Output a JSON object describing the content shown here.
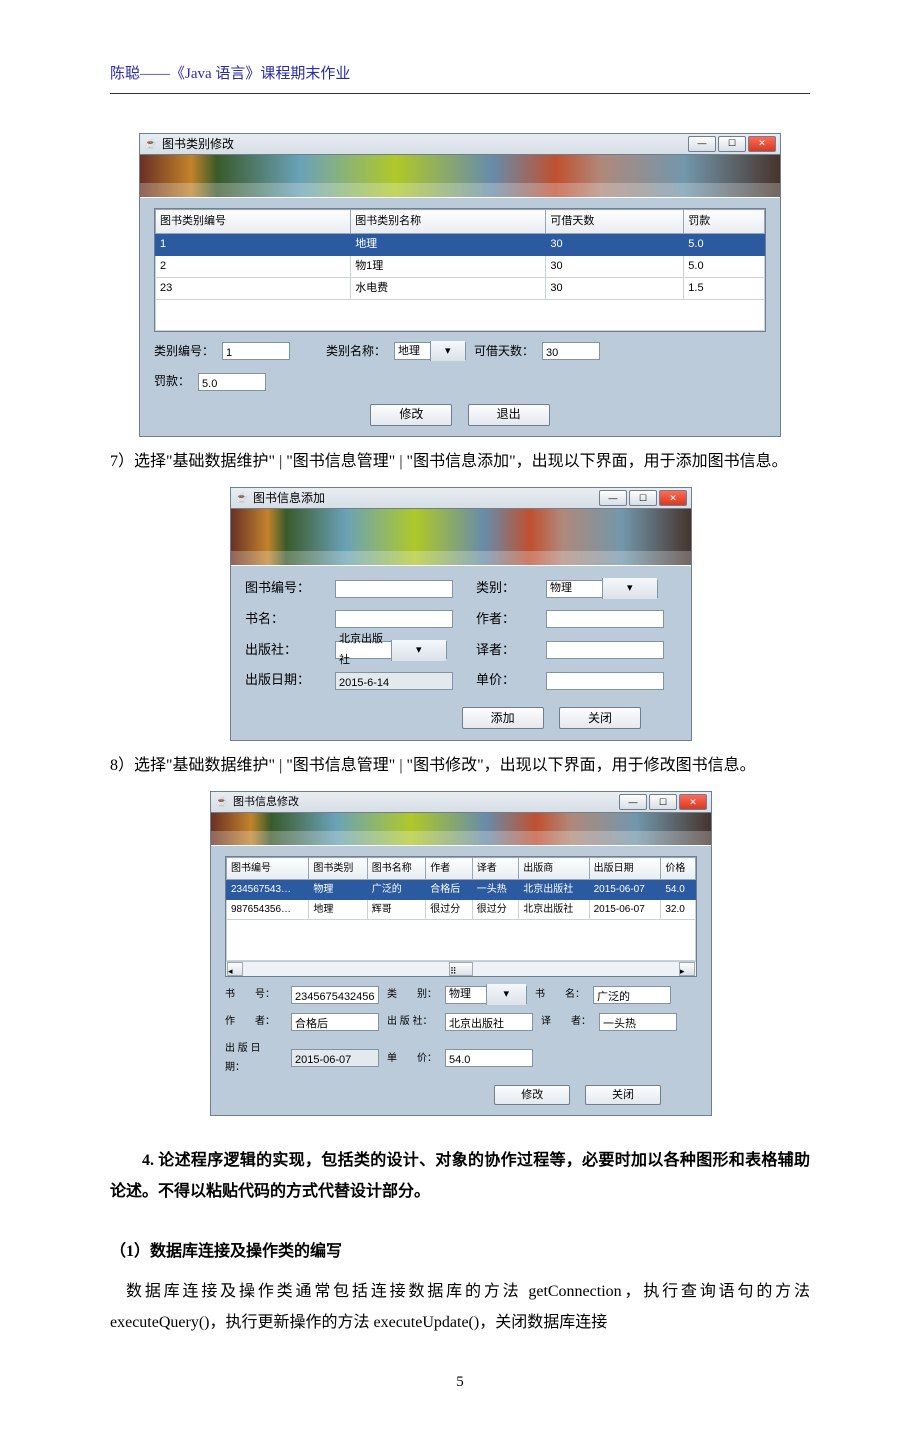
{
  "header": "陈聪——《Java 语言》课程期末作业",
  "page_number": "5",
  "para7": "7）选择\"基础数据维护\" | \"图书信息管理\" | \"图书信息添加\"，出现以下界面，用于添加图书信息。",
  "para8": "8）选择\"基础数据维护\" | \"图书信息管理\" | \"图书修改\"，出现以下界面，用于修改图书信息。",
  "sec4": "4. 论述程序逻辑的实现，包括类的设计、对象的协作过程等，必要时加以各种图形和表格辅助论述。不得以粘贴代码的方式代替设计部分。",
  "sub1_title": "（1）数据库连接及操作类的编写",
  "sub1_body": "数据库连接及操作类通常包括连接数据库的方法 getConnection，执行查询语句的方法 executeQuery()，执行更新操作的方法 executeUpdate()，关闭数据库连接",
  "win1": {
    "title": "图书类别修改",
    "cols": [
      "图书类别编号",
      "图书类别名称",
      "可借天数",
      "罚款"
    ],
    "rows": [
      {
        "id": "1",
        "name": "地理",
        "days": "30",
        "fine": "5.0",
        "sel": true
      },
      {
        "id": "2",
        "name": "物1理",
        "days": "30",
        "fine": "5.0"
      },
      {
        "id": "23",
        "name": "水电费",
        "days": "30",
        "fine": "1.5"
      }
    ],
    "l_id": "类别编号：",
    "v_id": "1",
    "l_name": "类别名称：",
    "v_name": "地理",
    "l_days": "可借天数：",
    "v_days": "30",
    "l_fine": "罚款：",
    "v_fine": "5.0",
    "btn_modify": "修改",
    "btn_exit": "退出"
  },
  "win2": {
    "title": "图书信息添加",
    "l_isbn": "图书编号：",
    "l_cat": "类别：",
    "v_cat": "物理",
    "l_name": "书名：",
    "l_author": "作者：",
    "l_pub": "出版社：",
    "v_pub": "北京出版社",
    "l_trans": "译者：",
    "l_date": "出版日期：",
    "v_date": "2015-6-14",
    "l_price": "单价：",
    "btn_add": "添加",
    "btn_close": "关闭"
  },
  "win3": {
    "title": "图书信息修改",
    "cols": [
      "图书编号",
      "图书类别",
      "图书名称",
      "作者",
      "译者",
      "出版商",
      "出版日期",
      "价格"
    ],
    "rows": [
      {
        "c": [
          "234567543…",
          "物理",
          "广泛的",
          "合格后",
          "一头热",
          "北京出版社",
          "2015-06-07",
          "54.0"
        ],
        "sel": true
      },
      {
        "c": [
          "987654356…",
          "地理",
          "辉哥",
          "很过分",
          "很过分",
          "北京出版社",
          "2015-06-07",
          "32.0"
        ]
      }
    ],
    "l_isbn": "书　　号：",
    "v_isbn": "2345675432456",
    "l_cat": "类　　别：",
    "v_cat": "物理",
    "l_name": "书　　名：",
    "v_name": "广泛的",
    "l_author": "作　　者：",
    "v_author": "合格后",
    "l_pub": "出 版 社：",
    "v_pub": "北京出版社",
    "l_trans": "译　　者：",
    "v_trans": "一头热",
    "l_date": "出 版 日 期：",
    "v_date": "2015-06-07",
    "l_price": "单　　价：",
    "v_price": "54.0",
    "btn_modify": "修改",
    "btn_close": "关闭"
  }
}
